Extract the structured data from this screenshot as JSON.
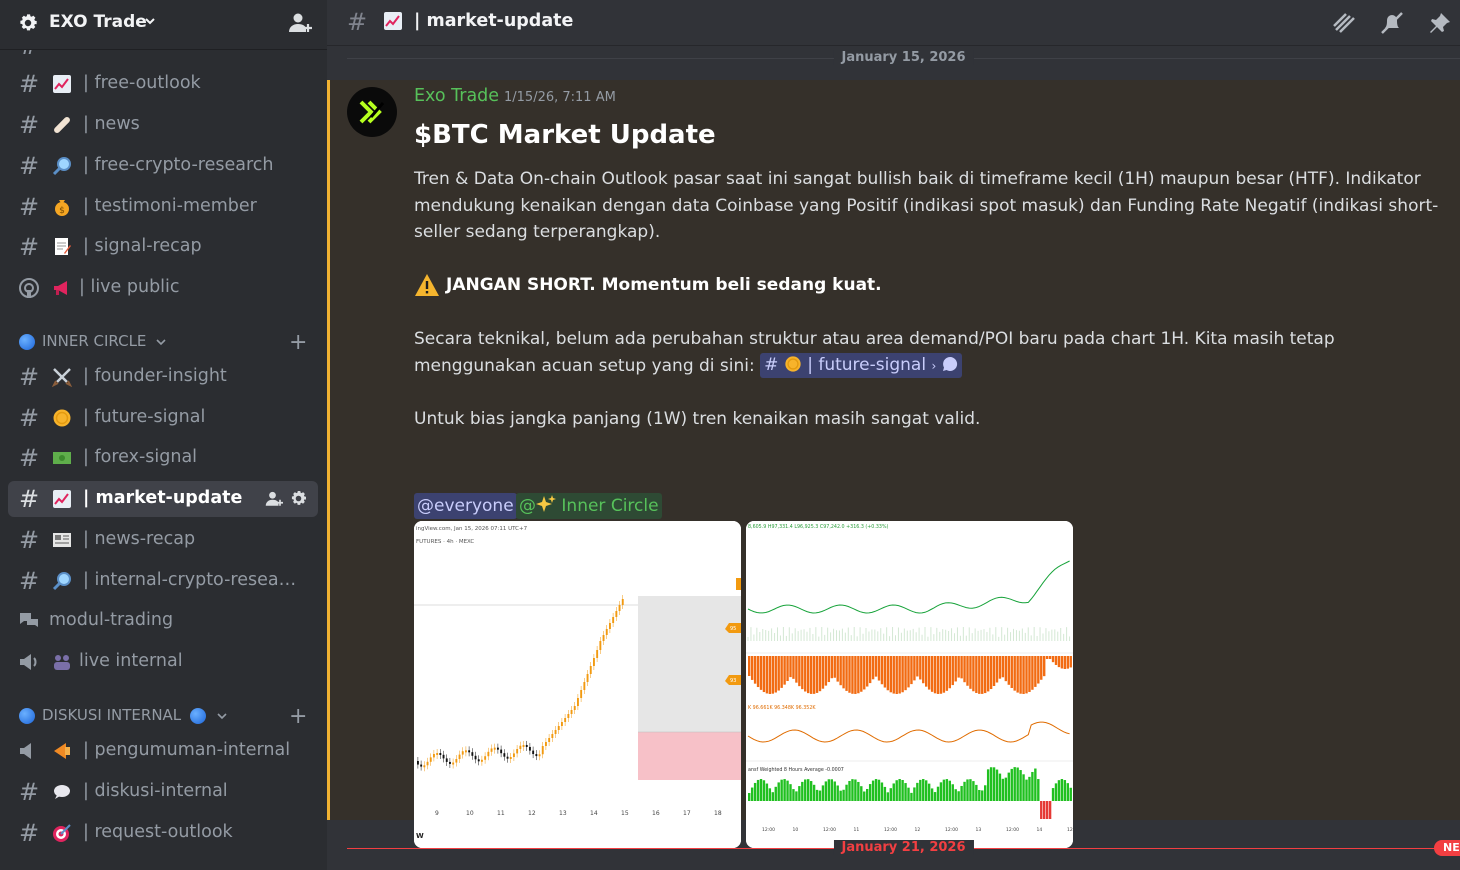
{
  "server": {
    "name": "EXO Trade",
    "icons": [
      "gear-icon",
      "chevron-down-icon",
      "invite-user-icon"
    ]
  },
  "sidebar": {
    "channels_top": [
      {
        "label": "| free-outlook",
        "emoji": "chart-up-emoji"
      },
      {
        "label": "| news",
        "emoji": "bandage-emoji"
      },
      {
        "label": "| free-crypto-research",
        "emoji": "magnifier-emoji"
      },
      {
        "label": "| testimoni-member",
        "emoji": "money-bag-emoji"
      },
      {
        "label": "| signal-recap",
        "emoji": "memo-emoji"
      },
      {
        "label": "| live public",
        "emoji": "megaphone-emoji"
      }
    ],
    "category_inner": {
      "name": "INNER CIRCLE",
      "plus": "+"
    },
    "channels_inner": [
      {
        "label": "| founder-insight",
        "emoji": "crossed-swords-emoji"
      },
      {
        "label": "| future-signal",
        "emoji": "coin-emoji"
      },
      {
        "label": "| forex-signal",
        "emoji": "dollar-bill-emoji"
      },
      {
        "label": "| market-update",
        "emoji": "chart-up-emoji"
      },
      {
        "label": "| news-recap",
        "emoji": "newspaper-emoji"
      },
      {
        "label": "| internal-crypto-resear...",
        "emoji": "magnifier-emoji"
      },
      {
        "label": "modul-trading",
        "emoji": ""
      },
      {
        "label": "live internal",
        "emoji": "people-emoji"
      }
    ],
    "category_diskusi": {
      "name": "DISKUSI INTERNAL",
      "plus": "+"
    },
    "channels_diskusi": [
      {
        "label": "| pengumuman-internal",
        "emoji": "loudspeaker-emoji"
      },
      {
        "label": "| diskusi-internal",
        "emoji": "speech-bubble-emoji"
      },
      {
        "label": "| request-outlook",
        "emoji": "target-emoji"
      }
    ]
  },
  "topbar": {
    "title": "| market-update",
    "icons": [
      "threads-icon",
      "mute-bell-icon",
      "pin-icon"
    ]
  },
  "main": {
    "date_divider_1": "January 15, 2026",
    "date_divider_2": "January 21, 2026",
    "new_tag": "NE",
    "message": {
      "author": "Exo Trade",
      "timestamp": "1/15/26, 7:11 AM",
      "title": "$BTC Market Update",
      "para1": "Tren & Data On-chain Outlook pasar saat ini sangat bullish baik di timeframe kecil (1H) maupun besar (HTF). Indikator mendukung kenaikan dengan data Coinbase yang Positif (indikasi spot masuk) dan Funding Rate Negatif (indikasi short-seller sedang terperangkap).",
      "warning": "JANGAN SHORT. Momentum beli sedang kuat.",
      "para3": "Secara teknikal, belum ada perubahan struktur atau area demand/POI baru pada chart 1H. Kita masih tetap menggunakan acuan setup yang di sini:",
      "channel_mention": "| future-signal",
      "para4": "Untuk bias jangka panjang (1W) tren kenaikan masih sangat valid.",
      "mention_everyone": "@everyone",
      "mention_role": "Inner Circle",
      "mention_role_prefix": "@"
    },
    "chart1": {
      "header1": "ingView.com, Jan 15, 2026 07:11 UTC+7",
      "header2": "FUTURES · 4h · MEXC",
      "x_ticks": [
        "9",
        "10",
        "11",
        "12",
        "13",
        "14",
        "15",
        "16",
        "17",
        "18"
      ],
      "corner": "W",
      "tags": [
        "95",
        "93"
      ]
    },
    "chart2": {
      "header1": "8,605.9 H97,331.4 L96,925.3 C97,242.0 +316.3 (+0.33%)",
      "header2": "K 96.661K 96.348K 96.352K",
      "header3": "ansf Weighted 8 Hours Average  -0.0007",
      "x_ticks": [
        "12:00",
        "10",
        "12:00",
        "11",
        "12:00",
        "12",
        "12:00",
        "13",
        "12:00",
        "14",
        "12"
      ]
    },
    "colors": {
      "accent_orange": "#f0b232",
      "author_green": "#57c15a",
      "danger": "#f23f42",
      "candle_orange": "#f29a10"
    }
  }
}
